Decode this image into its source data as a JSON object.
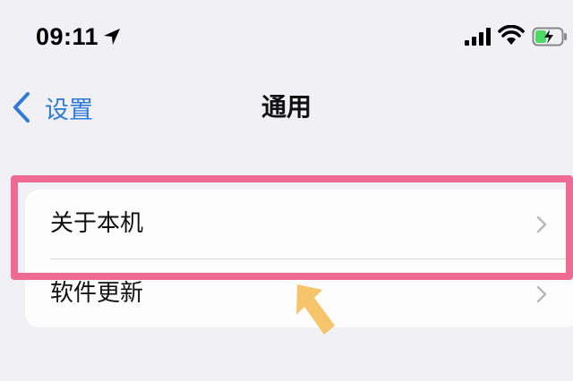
{
  "status_bar": {
    "time": "09:11",
    "icons": [
      "location-arrow-icon",
      "cellular-signal-icon",
      "wifi-icon",
      "battery-charging-icon"
    ]
  },
  "nav": {
    "back_label": "设置",
    "title": "通用"
  },
  "list": {
    "items": [
      {
        "label": "关于本机"
      },
      {
        "label": "软件更新"
      }
    ]
  },
  "colors": {
    "background": "#f0f0f5",
    "accent_blue": "#2f7bd9",
    "highlight_pink": "#ee6a92",
    "arrow_yellow": "#f5c46b",
    "battery_green": "#4cd964"
  }
}
